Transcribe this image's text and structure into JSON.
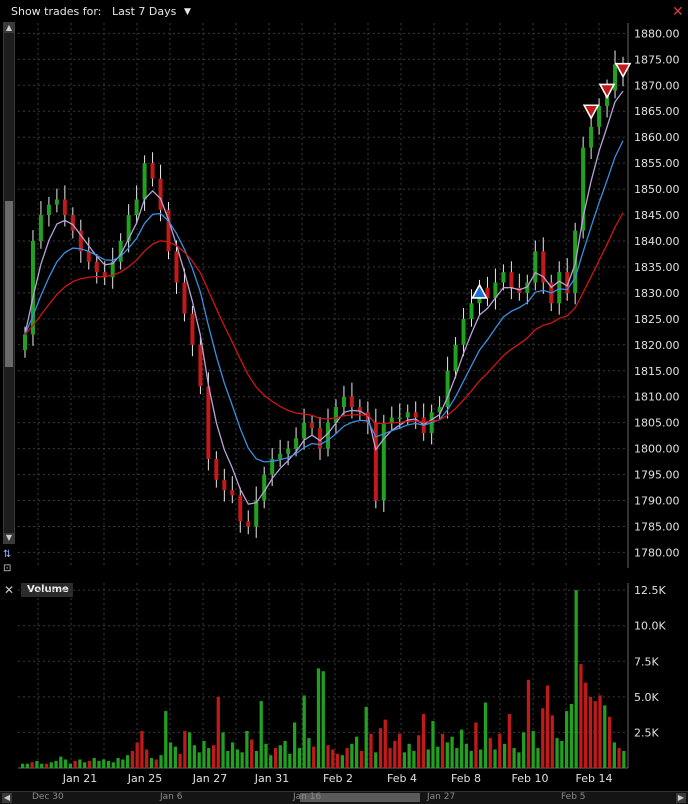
{
  "toolbar": {
    "show_label": "Show trades for:",
    "period": "Last 7 Days"
  },
  "volume_label": "Volume",
  "scroll_labels": [
    "Dec 30",
    "Jan 6",
    "Jan 16",
    "Jan 27",
    "Feb 5"
  ],
  "colors": {
    "up": "#22a022",
    "down": "#c01a1a",
    "grid": "#3a3a3a",
    "ma_fast": "#b9a2d6",
    "ma_mid": "#3a8fe0",
    "ma_slow": "#d01515"
  },
  "chart_data": [
    {
      "type": "candlestick",
      "x_tick_labels": [
        "Jan 21",
        "Jan 25",
        "Jan 27",
        "Jan 31",
        "Feb 2",
        "Feb 4",
        "Feb 8",
        "Feb 10",
        "Feb 14"
      ],
      "ylim": [
        1777,
        1882
      ],
      "y_ticks": [
        1780.0,
        1785.0,
        1790.0,
        1795.0,
        1800.0,
        1805.0,
        1810.0,
        1815.0,
        1820.0,
        1825.0,
        1830.0,
        1835.0,
        1840.0,
        1845.0,
        1850.0,
        1855.0,
        1860.0,
        1865.0,
        1870.0,
        1875.0,
        1880.0
      ],
      "close_path": [
        1822,
        1840,
        1845,
        1847,
        1848,
        1845,
        1842,
        1838,
        1836,
        1834,
        1833,
        1836,
        1840,
        1845,
        1848,
        1855,
        1852,
        1846,
        1838,
        1832,
        1826,
        1820,
        1812,
        1798,
        1794,
        1792,
        1791,
        1786,
        1785,
        1790,
        1795,
        1798,
        1799,
        1800,
        1802,
        1805,
        1804,
        1800,
        1805,
        1808,
        1810,
        1808,
        1807,
        1805,
        1790,
        1805,
        1806,
        1806,
        1807,
        1806,
        1803,
        1807,
        1808,
        1815,
        1820,
        1825,
        1828,
        1831,
        1829,
        1832,
        1834,
        1831,
        1830,
        1832,
        1838,
        1832,
        1828,
        1834,
        1830,
        1842,
        1858,
        1862,
        1866,
        1869,
        1874,
        1872
      ],
      "trade_markers": [
        {
          "side": "buy",
          "price": 1830
        },
        {
          "side": "sell",
          "price": 1865
        },
        {
          "side": "sell",
          "price": 1869
        },
        {
          "side": "sell",
          "price": 1873
        }
      ]
    },
    {
      "type": "bar",
      "title": "Volume",
      "ylim": [
        0,
        13000
      ],
      "y_tick_labels": [
        "12.5K",
        "10.0K",
        "7.5K",
        "5.0K",
        "2.5K"
      ],
      "y_tick_values": [
        12500,
        10000,
        7500,
        5000,
        2500
      ],
      "values": [
        300,
        300,
        400,
        500,
        300,
        300,
        400,
        500,
        800,
        600,
        300,
        500,
        600,
        400,
        500,
        700,
        500,
        600,
        500,
        400,
        700,
        600,
        900,
        1200,
        1800,
        2600,
        1300,
        700,
        600,
        900,
        4000,
        1800,
        1500,
        1000,
        2600,
        2500,
        1600,
        1100,
        1900,
        1400,
        1600,
        5000,
        2500,
        1200,
        1800,
        1300,
        1100,
        2600,
        2000,
        1200,
        4700,
        1700,
        900,
        1400,
        1600,
        1900,
        1000,
        3200,
        1400,
        5100,
        2100,
        1500,
        7000,
        6800,
        1600,
        1300,
        1000,
        900,
        1400,
        1700,
        2200,
        1200,
        4300,
        2400,
        1100,
        2800,
        3400,
        1400,
        1900,
        2400,
        1100,
        1700,
        1200,
        2300,
        3800,
        1300,
        3300,
        1500,
        2400,
        1800,
        2200,
        1400,
        2700,
        1700,
        1200,
        3200,
        1300,
        4600,
        2100,
        1300,
        2400,
        1700,
        3800,
        1400,
        1100,
        2500,
        6200,
        2600,
        1400,
        4200,
        5800,
        3700,
        2100,
        1900,
        4000,
        4500,
        12500,
        7300,
        6000,
        5000,
        4700,
        5100,
        4400,
        3600,
        1800,
        1400,
        1200
      ]
    }
  ]
}
